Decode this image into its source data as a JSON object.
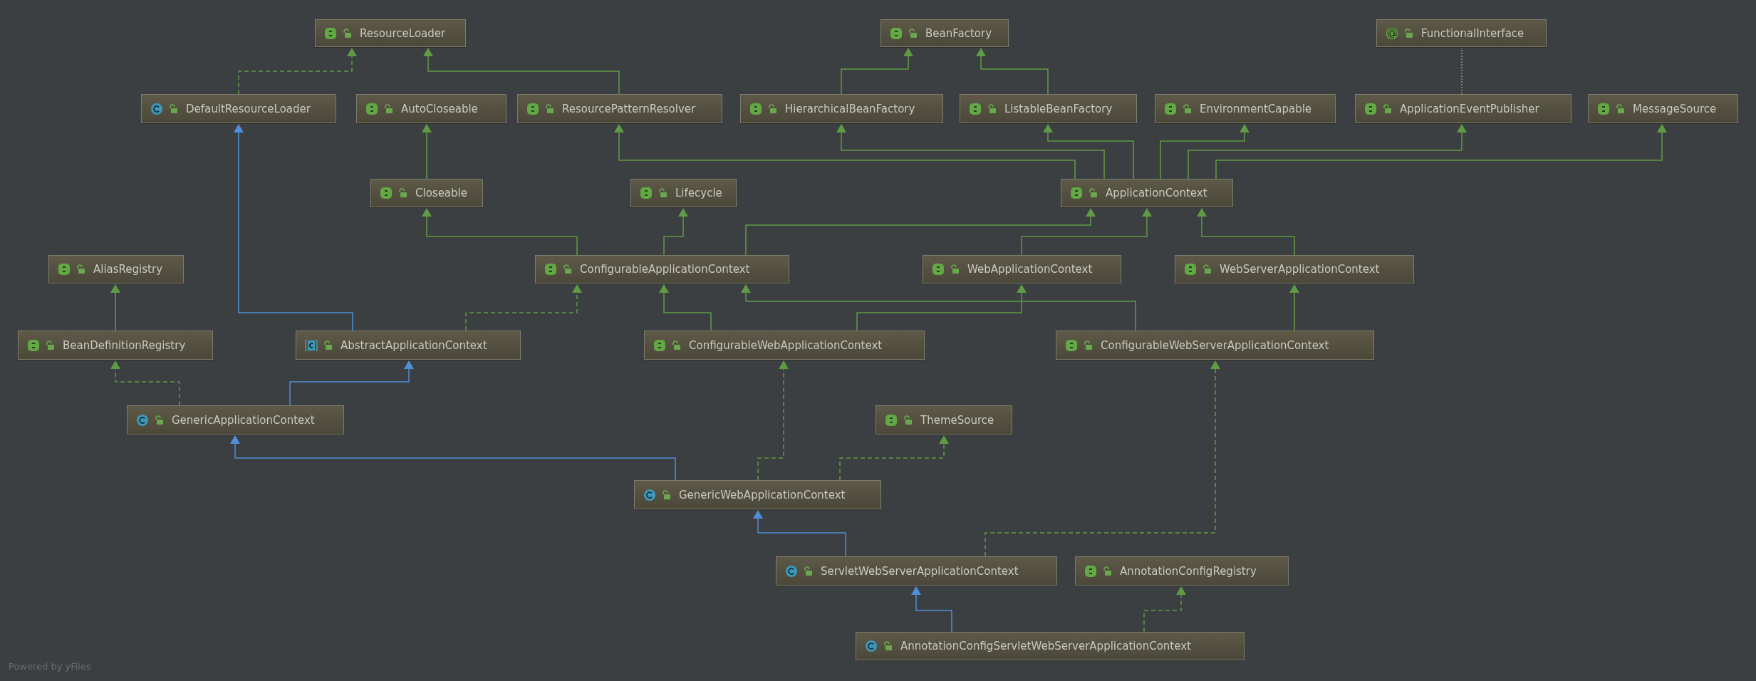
{
  "diagram": {
    "nodes": [
      {
        "name": "ResourceLoader",
        "kind": "interface"
      },
      {
        "name": "BeanFactory",
        "kind": "interface"
      },
      {
        "name": "FunctionalInterface",
        "kind": "annotation"
      },
      {
        "name": "DefaultResourceLoader",
        "kind": "class"
      },
      {
        "name": "AutoCloseable",
        "kind": "interface"
      },
      {
        "name": "ResourcePatternResolver",
        "kind": "interface"
      },
      {
        "name": "HierarchicalBeanFactory",
        "kind": "interface"
      },
      {
        "name": "ListableBeanFactory",
        "kind": "interface"
      },
      {
        "name": "EnvironmentCapable",
        "kind": "interface"
      },
      {
        "name": "ApplicationEventPublisher",
        "kind": "interface"
      },
      {
        "name": "MessageSource",
        "kind": "interface"
      },
      {
        "name": "Closeable",
        "kind": "interface"
      },
      {
        "name": "Lifecycle",
        "kind": "interface"
      },
      {
        "name": "ApplicationContext",
        "kind": "interface"
      },
      {
        "name": "AliasRegistry",
        "kind": "interface"
      },
      {
        "name": "ConfigurableApplicationContext",
        "kind": "interface"
      },
      {
        "name": "WebApplicationContext",
        "kind": "interface"
      },
      {
        "name": "WebServerApplicationContext",
        "kind": "interface"
      },
      {
        "name": "BeanDefinitionRegistry",
        "kind": "interface"
      },
      {
        "name": "AbstractApplicationContext",
        "kind": "abstract"
      },
      {
        "name": "ConfigurableWebApplicationContext",
        "kind": "interface"
      },
      {
        "name": "ConfigurableWebServerApplicationContext",
        "kind": "interface"
      },
      {
        "name": "GenericApplicationContext",
        "kind": "class"
      },
      {
        "name": "ThemeSource",
        "kind": "interface"
      },
      {
        "name": "GenericWebApplicationContext",
        "kind": "class"
      },
      {
        "name": "ServletWebServerApplicationContext",
        "kind": "class"
      },
      {
        "name": "AnnotationConfigRegistry",
        "kind": "interface"
      },
      {
        "name": "AnnotationConfigServletWebServerApplicationContext",
        "kind": "class"
      }
    ],
    "edges": [
      {
        "kind": "implements"
      },
      {
        "kind": "inherits"
      },
      {
        "kind": "inherits"
      },
      {
        "kind": "inherits"
      },
      {
        "kind": "annotated"
      },
      {
        "kind": "inherits"
      },
      {
        "kind": "inherits"
      },
      {
        "kind": "inherits"
      },
      {
        "kind": "inherits"
      },
      {
        "kind": "inherits"
      },
      {
        "kind": "inherits"
      },
      {
        "kind": "inherits"
      },
      {
        "kind": "inherits"
      },
      {
        "kind": "inherits"
      },
      {
        "kind": "inherits"
      },
      {
        "kind": "inherits"
      },
      {
        "kind": "inherits"
      },
      {
        "kind": "inherits"
      },
      {
        "kind": "extends"
      },
      {
        "kind": "implements"
      },
      {
        "kind": "inherits"
      },
      {
        "kind": "inherits"
      },
      {
        "kind": "inherits"
      },
      {
        "kind": "inherits"
      },
      {
        "kind": "implements"
      },
      {
        "kind": "extends"
      },
      {
        "kind": "extends"
      },
      {
        "kind": "implements"
      },
      {
        "kind": "implements"
      },
      {
        "kind": "extends"
      },
      {
        "kind": "implements"
      },
      {
        "kind": "extends"
      },
      {
        "kind": "implements"
      }
    ]
  },
  "footer": "Powered by yFiles"
}
